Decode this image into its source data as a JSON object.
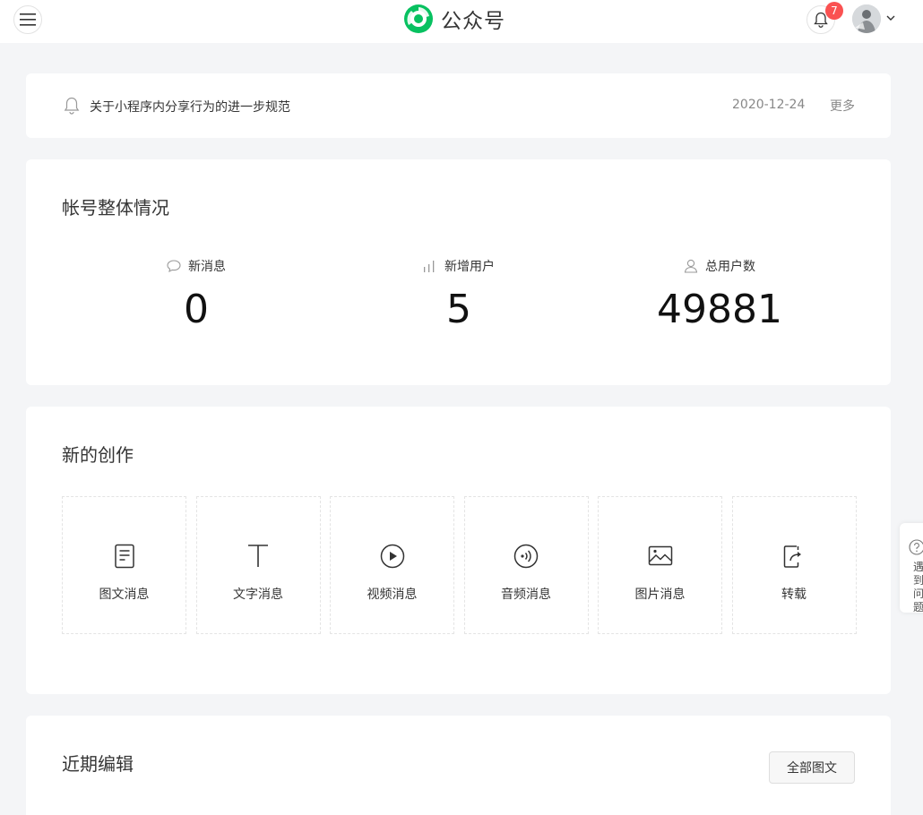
{
  "header": {
    "brand_name": "公众号",
    "notification_count": "7"
  },
  "notice": {
    "text": "关于小程序内分享行为的进一步规范",
    "date": "2020-12-24",
    "more_label": "更多"
  },
  "overview": {
    "title": "帐号整体情况",
    "stats": [
      {
        "label": "新消息",
        "value": "0",
        "icon": "chat-bubble-icon"
      },
      {
        "label": "新增用户",
        "value": "5",
        "icon": "bar-chart-icon"
      },
      {
        "label": "总用户数",
        "value": "49881",
        "icon": "user-icon"
      }
    ]
  },
  "create": {
    "title": "新的创作",
    "items": [
      {
        "label": "图文消息",
        "icon": "article-icon"
      },
      {
        "label": "文字消息",
        "icon": "text-icon"
      },
      {
        "label": "视频消息",
        "icon": "play-circle-icon"
      },
      {
        "label": "音频消息",
        "icon": "audio-icon"
      },
      {
        "label": "图片消息",
        "icon": "image-icon"
      },
      {
        "label": "转载",
        "icon": "share-icon"
      }
    ]
  },
  "recent": {
    "title": "近期编辑",
    "all_button": "全部图文"
  },
  "help": {
    "text": "遇到问题"
  },
  "colors": {
    "brand_green": "#07c160",
    "badge_red": "#fa5151",
    "background": "#f4f5f7"
  }
}
